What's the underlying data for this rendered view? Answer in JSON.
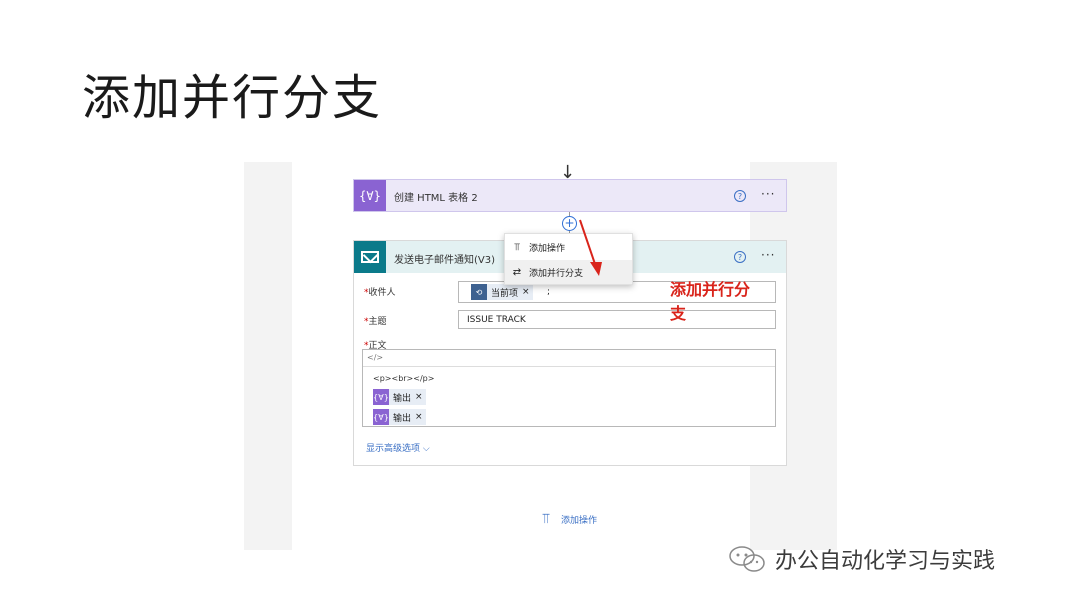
{
  "slide": {
    "title": "添加并行分支"
  },
  "flow": {
    "html_card": {
      "title": "创建 HTML 表格 2",
      "icon": "{∀}",
      "help": "?",
      "more": "···"
    },
    "plus_label": "+",
    "mail_card": {
      "title": "发送电子邮件通知(V3)",
      "help": "?",
      "more": "···",
      "to_label": "收件人",
      "to_token": "当前项",
      "to_sep": ";",
      "subject_label": "主题",
      "subject_value": "ISSUE TRACK",
      "body_label": "正文",
      "code_icon": "</>",
      "body_html": "<p><br></p>",
      "output1": "输出",
      "output2": "输出",
      "advanced": "显示高级选项"
    },
    "context_menu": {
      "add_action": "添加操作",
      "add_parallel": "添加并行分支"
    },
    "annotation": "添加并行分支",
    "bottom_add": "添加操作",
    "required_mark": "*",
    "token_close": "×"
  },
  "watermark": {
    "text": "办公自动化学习与实践",
    "icon": "wechat-icon"
  },
  "colors": {
    "accent_purple": "#8a63d2",
    "mail_teal": "#0b7a8a",
    "link_blue": "#3a6fc4",
    "annotation_red": "#d9241b"
  }
}
